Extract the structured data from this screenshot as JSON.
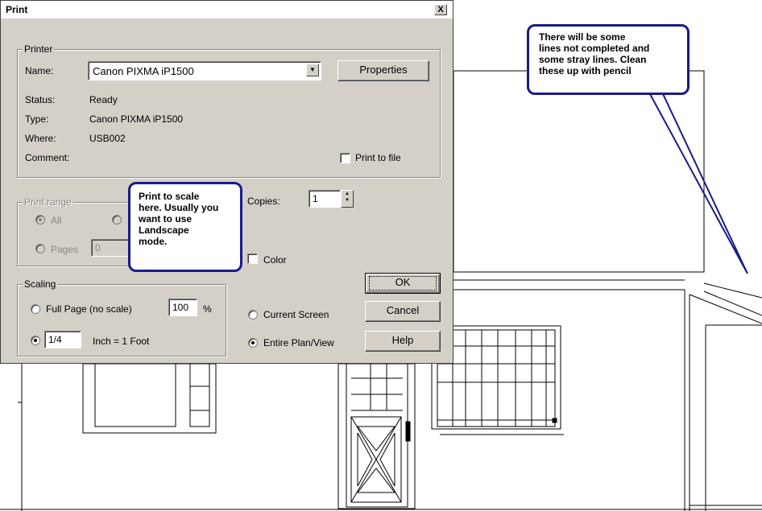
{
  "dialog": {
    "title": "Print",
    "close_label": "X",
    "printer": {
      "group_label": "Printer",
      "name_label": "Name:",
      "name_value": "Canon PIXMA iP1500",
      "properties_label": "Properties",
      "status_label": "Status:",
      "status_value": "Ready",
      "type_label": "Type:",
      "type_value": "Canon PIXMA iP1500",
      "where_label": "Where:",
      "where_value": "USB002",
      "comment_label": "Comment:",
      "print_to_file_label": "Print to file"
    },
    "print_range": {
      "group_label": "Print range",
      "all_label": "All",
      "pages_label": "Pages",
      "pages_value": "0"
    },
    "copies": {
      "label": "Copies:",
      "value": "1"
    },
    "color_label": "Color",
    "scaling": {
      "group_label": "Scaling",
      "full_page_label": "Full Page (no scale)",
      "percent_value": "100",
      "percent_symbol": "%",
      "scale_value": "1/4",
      "scale_suffix": "Inch = 1 Foot"
    },
    "view": {
      "current_screen_label": "Current Screen",
      "entire_plan_label": "Entire Plan/View"
    },
    "buttons": {
      "ok": "OK",
      "cancel": "Cancel",
      "help": "Help"
    }
  },
  "callouts": {
    "right": [
      "There will be some",
      "lines not completed and",
      "some stray lines. Clean",
      "these up with pencil"
    ],
    "left": [
      "Print to scale",
      "here. Usually you",
      "want to use",
      "Landscape",
      "mode."
    ]
  },
  "colors": {
    "callout_border": "#1a1a8c",
    "dialog_face": "#d4d0c8",
    "title_bar": "#ffffff"
  }
}
